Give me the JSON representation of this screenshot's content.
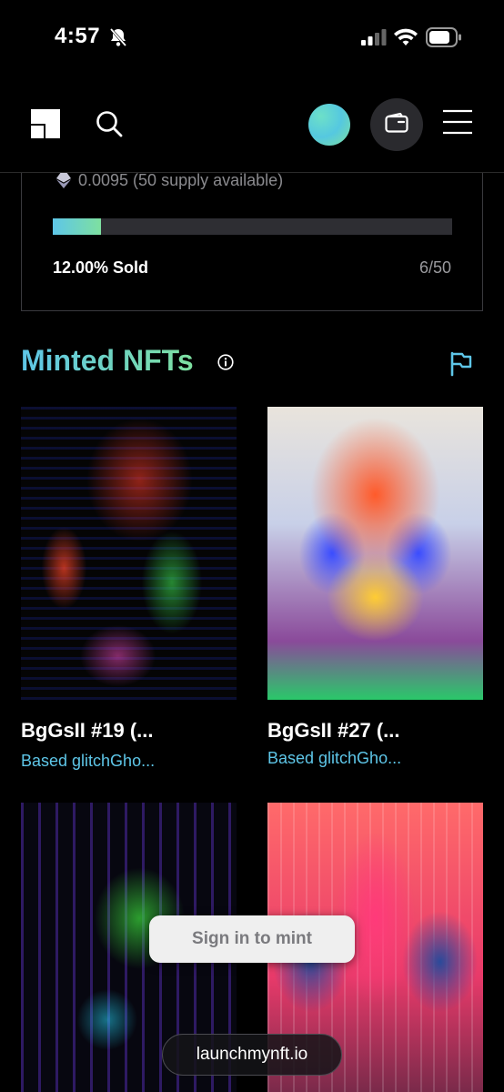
{
  "status_bar": {
    "time": "4:57"
  },
  "nav": {
    "icons": [
      "logo-icon",
      "search-icon",
      "avatar",
      "wallet-icon",
      "menu-icon"
    ]
  },
  "mint_card": {
    "price": "0.0095 (50 supply available)",
    "progress_fraction": 0.12,
    "sold_label": "12.00% Sold",
    "sold_count": "6/50"
  },
  "section": {
    "title": "Minted NFTs"
  },
  "nfts": [
    {
      "name": "BgGsII #19 (...",
      "collection": "Based glitchGho..."
    },
    {
      "name": "BgGsII #27 (...",
      "collection": "Based glitchGho..."
    },
    {
      "name": "",
      "collection": ""
    },
    {
      "name": "",
      "collection": ""
    }
  ],
  "actions": {
    "sign_in_label": "Sign in to mint",
    "domain_label": "launchmynft.io"
  },
  "colors": {
    "accent_gradient_start": "#5ec6e8",
    "accent_gradient_end": "#7ee0a0",
    "background": "#000000"
  }
}
